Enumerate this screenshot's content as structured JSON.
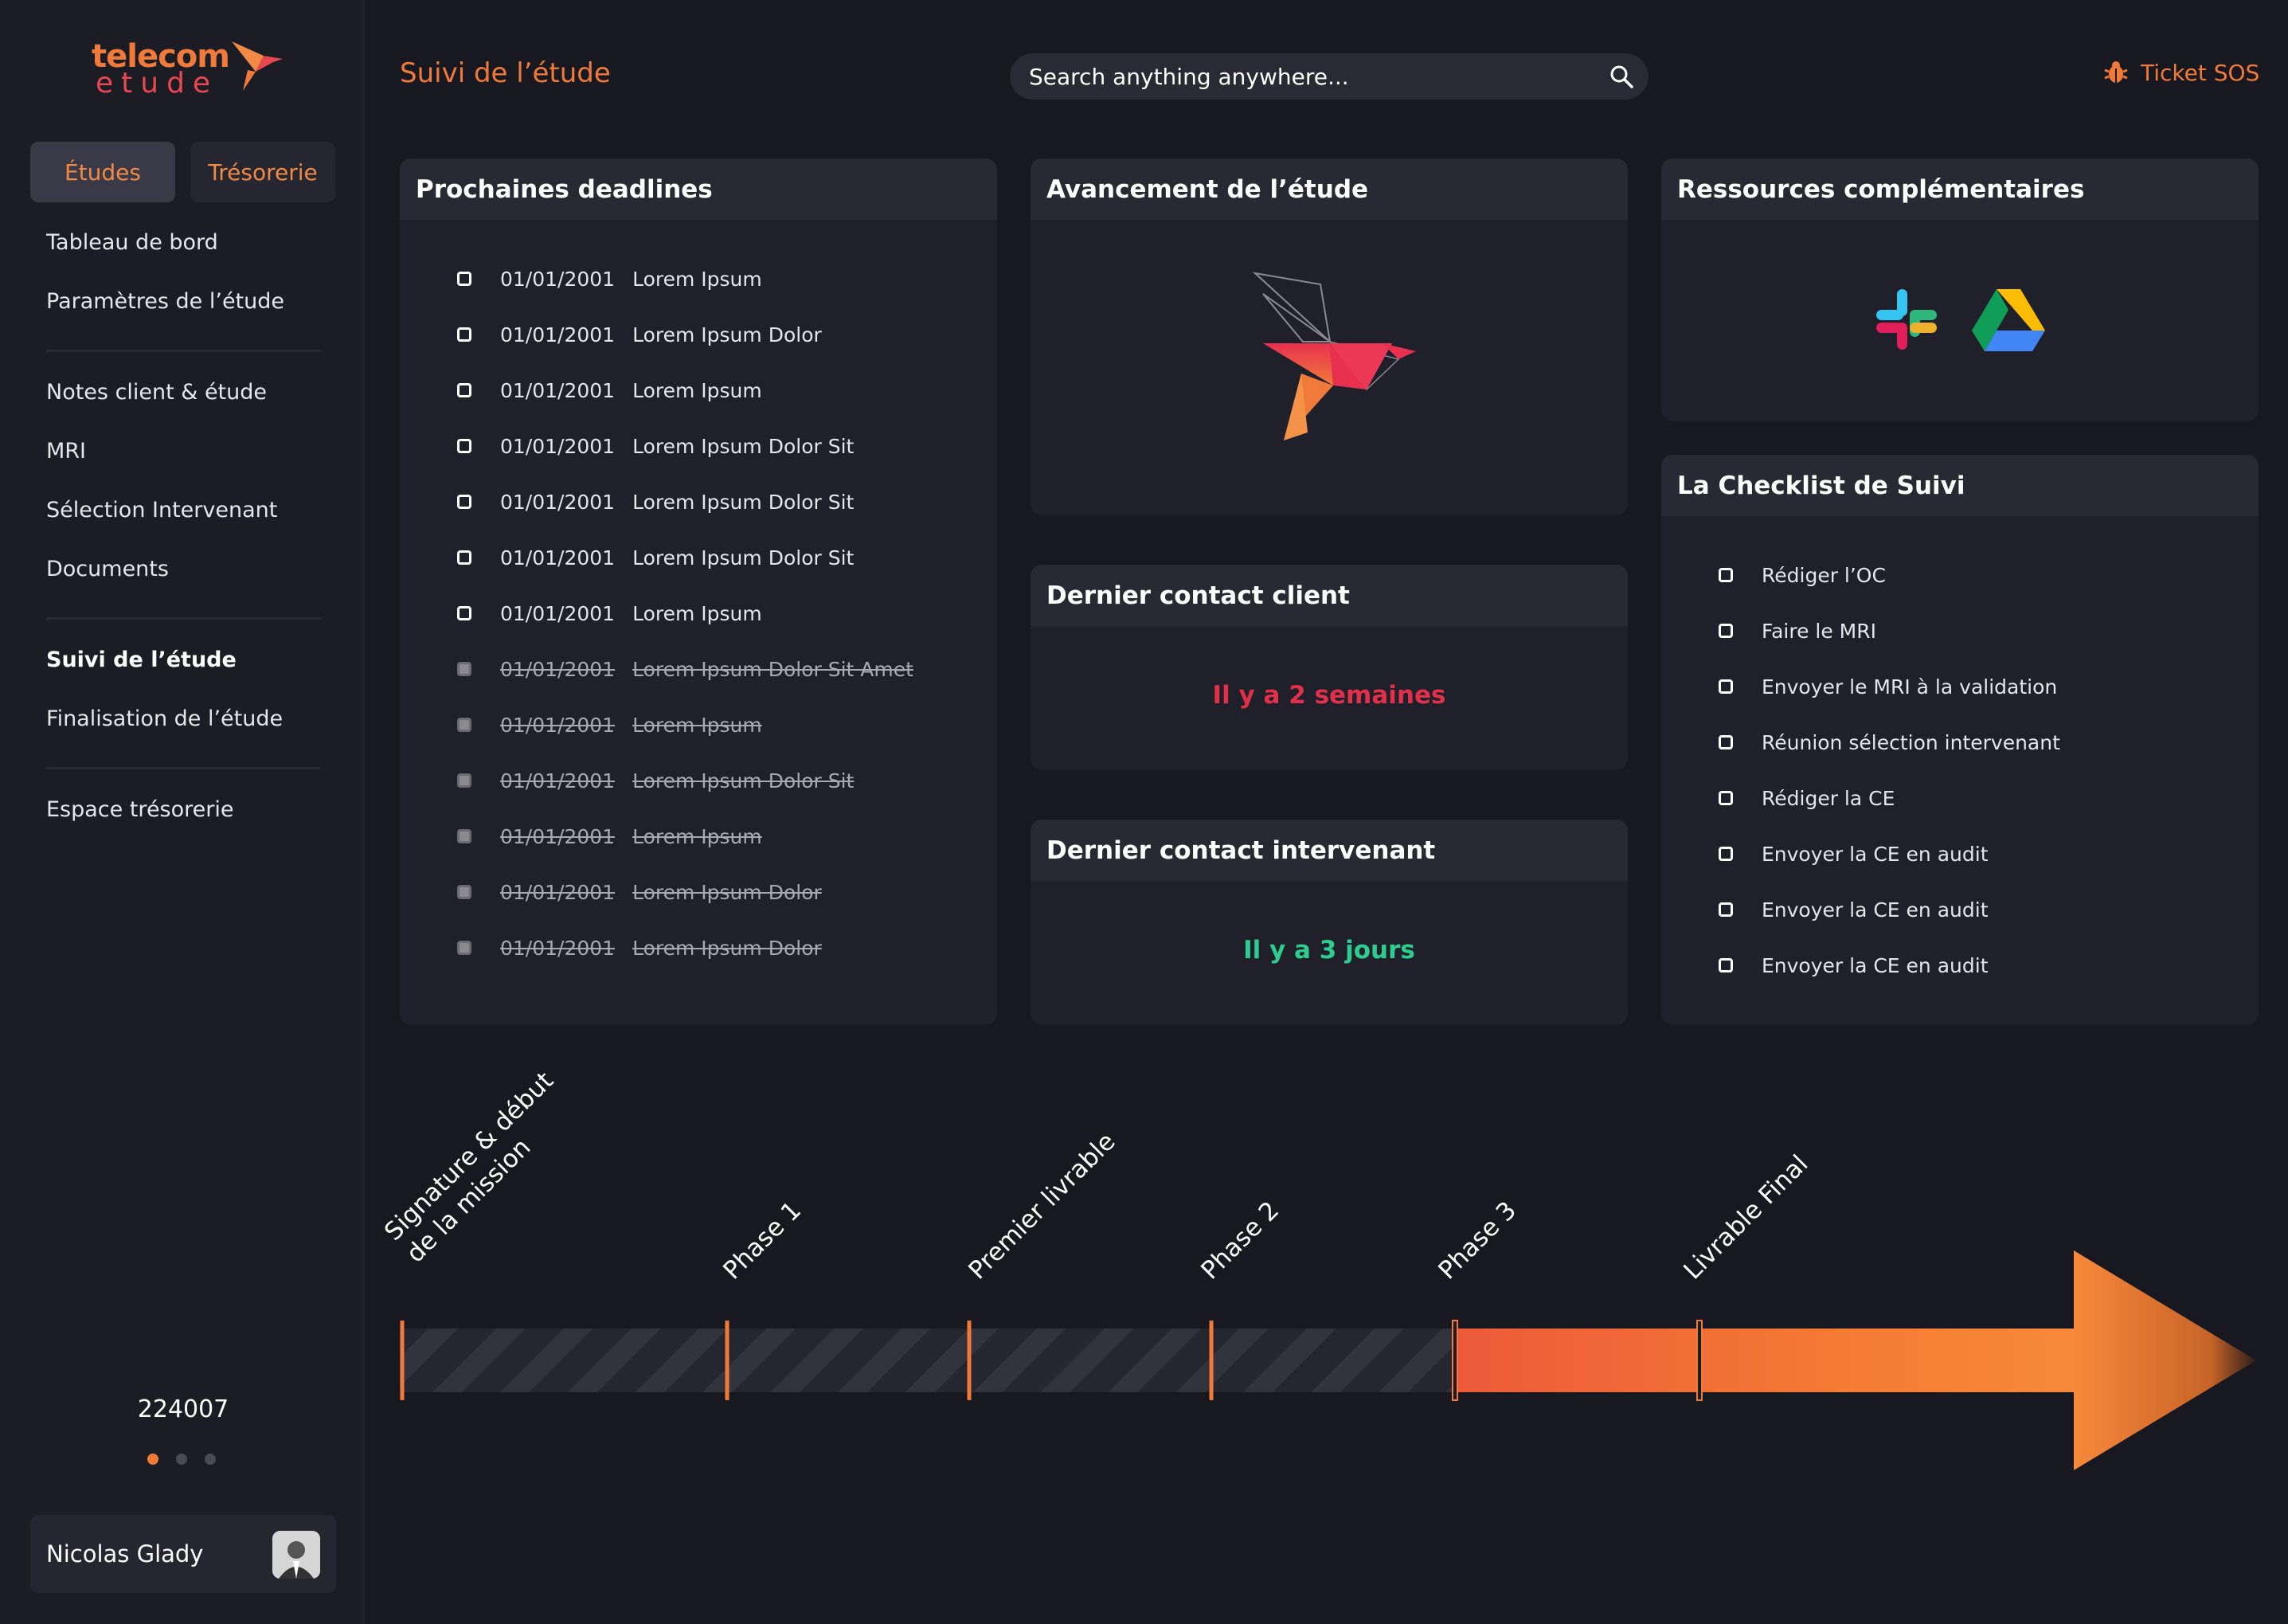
{
  "app": {
    "logo_word1": "telecom",
    "logo_word2": "etude"
  },
  "sidebar": {
    "tabs": [
      {
        "label": "Études"
      },
      {
        "label": "Trésorerie"
      }
    ],
    "items": [
      {
        "label": "Tableau de bord"
      },
      {
        "label": "Paramètres de l’étude"
      },
      {
        "label": "Notes client & étude"
      },
      {
        "label": "MRI"
      },
      {
        "label": "Sélection Intervenant"
      },
      {
        "label": "Documents"
      },
      {
        "label": "Suivi de l’étude"
      },
      {
        "label": "Finalisation de l’étude"
      },
      {
        "label": "Espace trésorerie"
      }
    ],
    "study_code": "224007",
    "user": {
      "name": "Nicolas Glady"
    }
  },
  "header": {
    "title": "Suivi de l’étude",
    "search_placeholder": "Search anything anywhere...",
    "sos_label": "Ticket SOS"
  },
  "deadlines": {
    "title": "Prochaines deadlines",
    "items": [
      {
        "date": "01/01/2001",
        "label": "Lorem Ipsum"
      },
      {
        "date": "01/01/2001",
        "label": "Lorem Ipsum Dolor"
      },
      {
        "date": "01/01/2001",
        "label": "Lorem Ipsum"
      },
      {
        "date": "01/01/2001",
        "label": "Lorem Ipsum Dolor Sit"
      },
      {
        "date": "01/01/2001",
        "label": "Lorem Ipsum Dolor Sit"
      },
      {
        "date": "01/01/2001",
        "label": "Lorem Ipsum Dolor Sit"
      },
      {
        "date": "01/01/2001",
        "label": "Lorem Ipsum"
      },
      {
        "date": "01/01/2001",
        "label": "Lorem Ipsum Dolor Sit Amet"
      },
      {
        "date": "01/01/2001",
        "label": "Lorem Ipsum"
      },
      {
        "date": "01/01/2001",
        "label": "Lorem Ipsum Dolor Sit"
      },
      {
        "date": "01/01/2001",
        "label": "Lorem Ipsum"
      },
      {
        "date": "01/01/2001",
        "label": "Lorem Ipsum Dolor"
      },
      {
        "date": "01/01/2001",
        "label": "Lorem Ipsum Dolor"
      }
    ],
    "done": [
      false,
      false,
      false,
      false,
      false,
      false,
      false,
      true,
      true,
      true,
      true,
      true,
      true
    ]
  },
  "progress": {
    "title": "Avancement de l’étude"
  },
  "last_contact_client": {
    "title": "Dernier contact client",
    "value": "Il y a 2 semaines",
    "color": "#e0304a"
  },
  "last_contact_intervenant": {
    "title": "Dernier contact intervenant",
    "value": "Il y a 3 jours",
    "color": "#2ecc8f"
  },
  "resources": {
    "title": "Ressources complémentaires",
    "icons": [
      "slack-icon",
      "google-drive-icon"
    ]
  },
  "checklist": {
    "title": "La Checklist de Suivi",
    "items": [
      {
        "label": "Rédiger l’OC"
      },
      {
        "label": "Faire le MRI"
      },
      {
        "label": "Envoyer le MRI à la validation"
      },
      {
        "label": "Réunion sélection intervenant"
      },
      {
        "label": "Rédiger la CE"
      },
      {
        "label": "Envoyer la CE en audit"
      },
      {
        "label": "Envoyer la CE en audit"
      },
      {
        "label": "Envoyer la CE en audit"
      }
    ]
  },
  "timeline": {
    "milestones": [
      {
        "label": "Signature & début\nde la mission"
      },
      {
        "label": "Phase 1"
      },
      {
        "label": "Premier livrable"
      },
      {
        "label": "Phase 2"
      },
      {
        "label": "Phase 3"
      },
      {
        "label": "Livrable Final"
      }
    ],
    "completed_segments": 4
  },
  "colors": {
    "accent": "#f07a3a",
    "background": "#181820",
    "card": "#20202a",
    "card_header": "#292934"
  }
}
